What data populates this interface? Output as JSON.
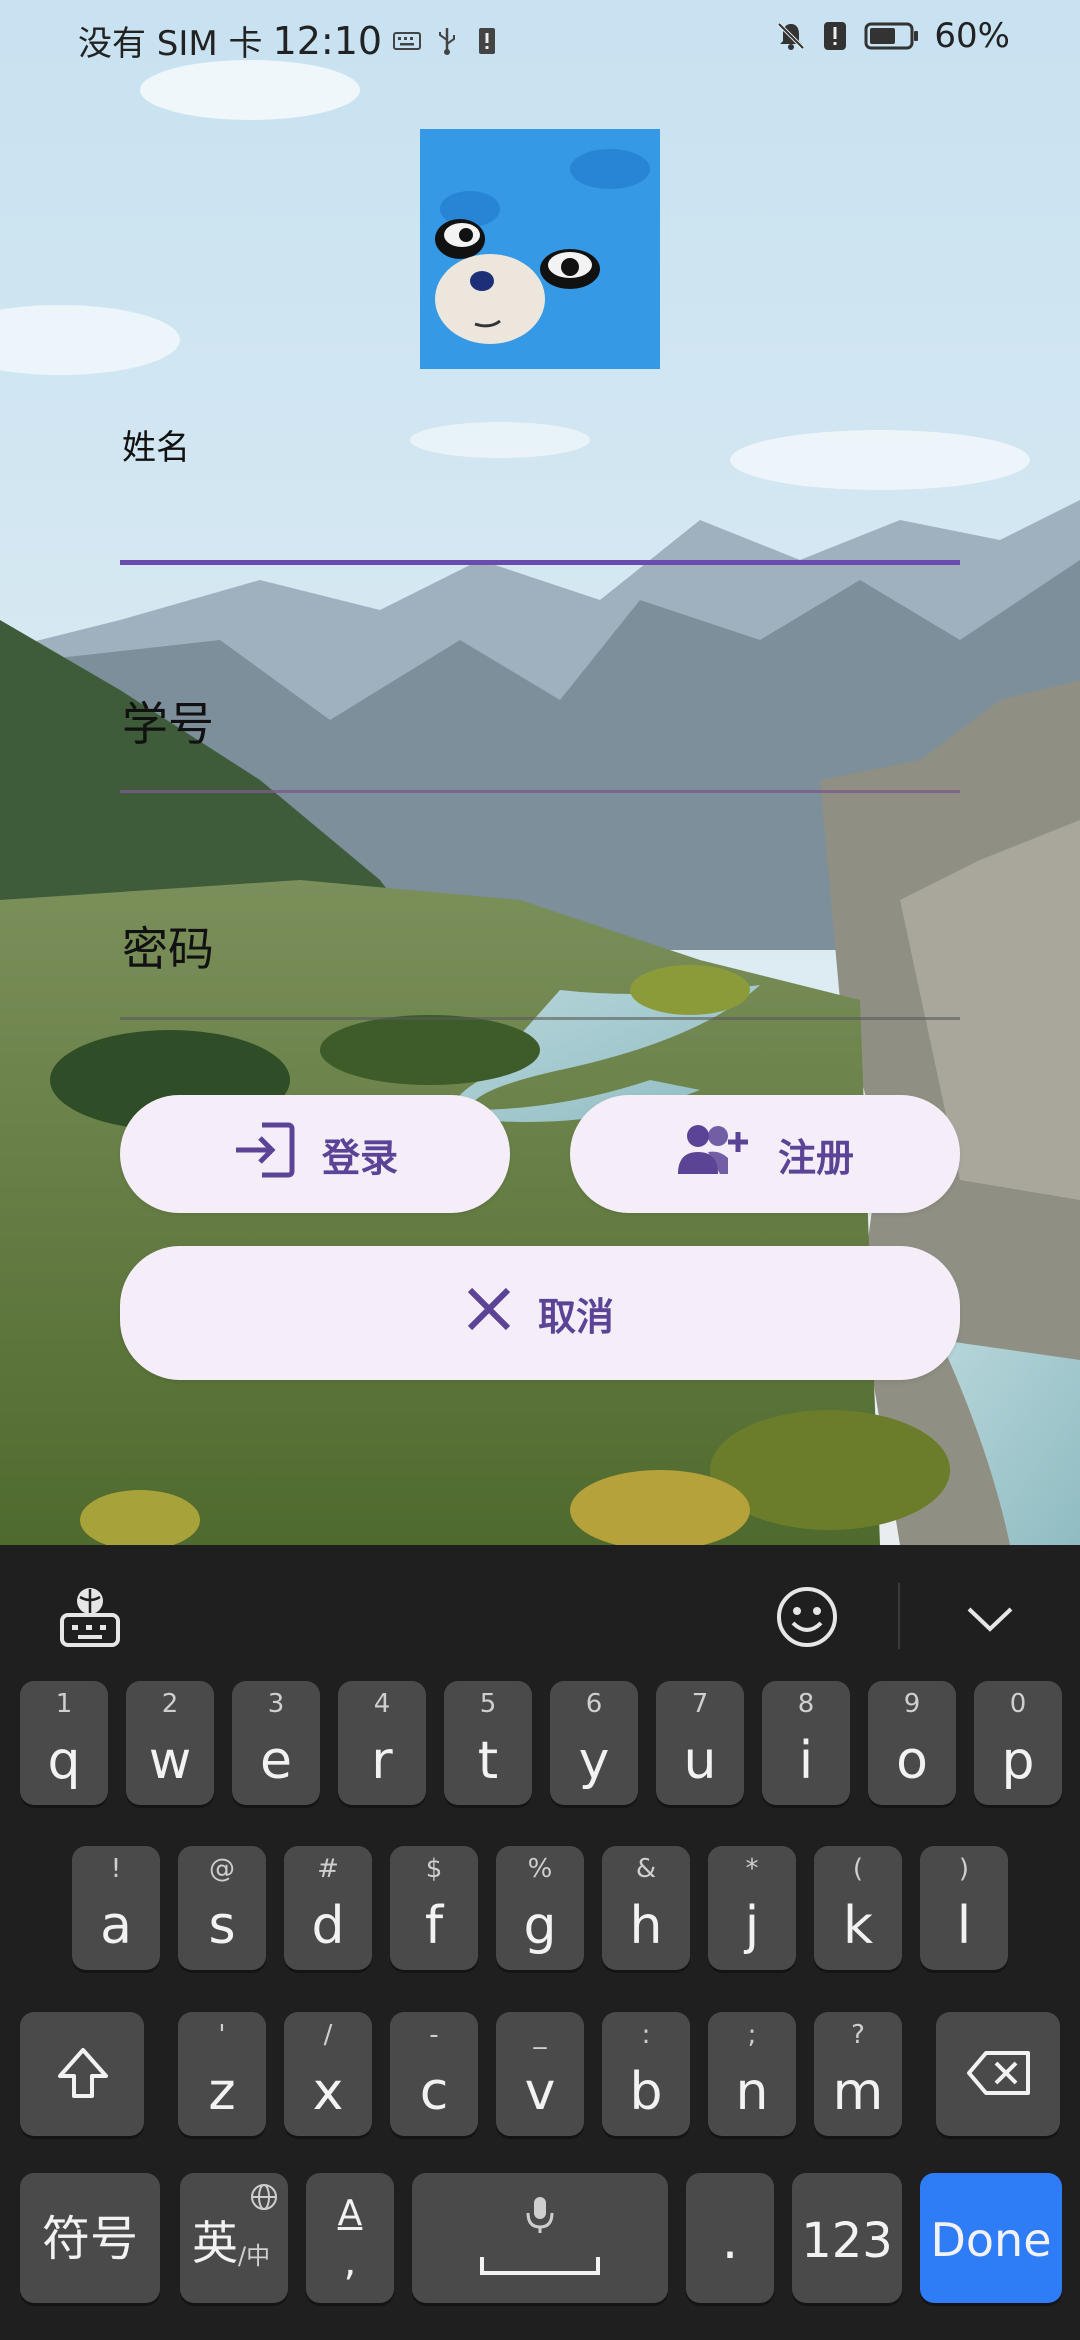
{
  "status_bar": {
    "carrier": "没有 SIM 卡",
    "time": "12:10",
    "battery": "60%"
  },
  "form": {
    "name_label": "姓名",
    "id_label": "学号",
    "password_label": "密码"
  },
  "buttons": {
    "login": "登录",
    "register": "注册",
    "cancel": "取消"
  },
  "keyboard": {
    "row1": [
      {
        "num": "1",
        "char": "q"
      },
      {
        "num": "2",
        "char": "w"
      },
      {
        "num": "3",
        "char": "e"
      },
      {
        "num": "4",
        "char": "r"
      },
      {
        "num": "5",
        "char": "t"
      },
      {
        "num": "6",
        "char": "y"
      },
      {
        "num": "7",
        "char": "u"
      },
      {
        "num": "8",
        "char": "i"
      },
      {
        "num": "9",
        "char": "o"
      },
      {
        "num": "0",
        "char": "p"
      }
    ],
    "row2": [
      {
        "sym": "!",
        "char": "a"
      },
      {
        "sym": "@",
        "char": "s"
      },
      {
        "sym": "#",
        "char": "d"
      },
      {
        "sym": "$",
        "char": "f"
      },
      {
        "sym": "%",
        "char": "g"
      },
      {
        "sym": "&",
        "char": "h"
      },
      {
        "sym": "*",
        "char": "j"
      },
      {
        "sym": "(",
        "char": "k"
      },
      {
        "sym": ")",
        "char": "l"
      }
    ],
    "row3": [
      {
        "sym": "'",
        "char": "z"
      },
      {
        "sym": "/",
        "char": "x"
      },
      {
        "sym": "-",
        "char": "c"
      },
      {
        "sym": "_",
        "char": "v"
      },
      {
        "sym": ":",
        "char": "b"
      },
      {
        "sym": ";",
        "char": "n"
      },
      {
        "sym": "?",
        "char": "m"
      }
    ],
    "symbols_key": "符号",
    "lang_key_main": "英",
    "lang_key_sub": "/中",
    "punct_key_top": "A",
    "punct_key_bottom": ",",
    "period_key": ".",
    "numbers_key": "123",
    "done_key": "Done"
  },
  "colors": {
    "accent": "#5b4496",
    "underline_active": "#6a4cae",
    "button_bg": "#f5eef9",
    "keyboard_bg": "#1f1f1f",
    "key_bg": "#4a4a4a",
    "done_bg": "#2e7cf6"
  }
}
